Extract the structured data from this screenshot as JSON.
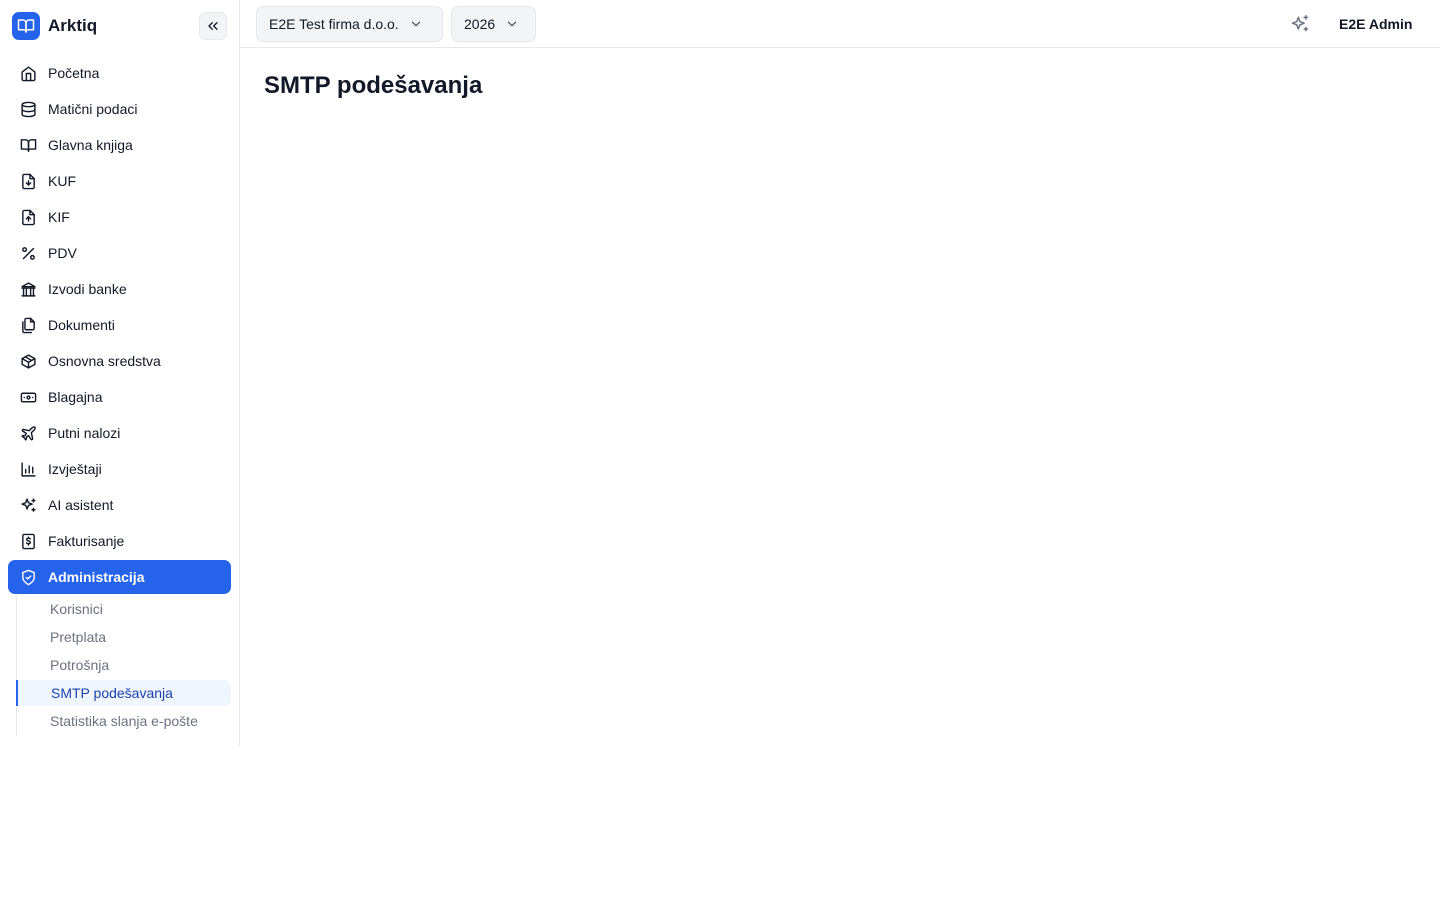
{
  "app": {
    "name": "Arktiq"
  },
  "sidebar": {
    "items": [
      {
        "label": "Početna",
        "icon": "home-icon"
      },
      {
        "label": "Matični podaci",
        "icon": "database-icon"
      },
      {
        "label": "Glavna knjiga",
        "icon": "book-open-icon"
      },
      {
        "label": "KUF",
        "icon": "file-download-icon"
      },
      {
        "label": "KIF",
        "icon": "file-upload-icon"
      },
      {
        "label": "PDV",
        "icon": "percent-icon"
      },
      {
        "label": "Izvodi banke",
        "icon": "bank-icon"
      },
      {
        "label": "Dokumenti",
        "icon": "files-icon"
      },
      {
        "label": "Osnovna sredstva",
        "icon": "package-icon"
      },
      {
        "label": "Blagajna",
        "icon": "banknote-icon"
      },
      {
        "label": "Putni nalozi",
        "icon": "plane-icon"
      },
      {
        "label": "Izvještaji",
        "icon": "bar-chart-icon"
      },
      {
        "label": "AI asistent",
        "icon": "sparkles-icon"
      },
      {
        "label": "Fakturisanje",
        "icon": "receipt-dollar-icon"
      },
      {
        "label": "Administracija",
        "icon": "shield-check-icon",
        "active": true
      }
    ],
    "subitems": [
      {
        "label": "Korisnici"
      },
      {
        "label": "Pretplata"
      },
      {
        "label": "Potrošnja"
      },
      {
        "label": "SMTP podešavanja",
        "active": true
      },
      {
        "label": "Statistika slanja e-pošte"
      }
    ]
  },
  "topbar": {
    "company": "E2E Test firma d.o.o.",
    "year": "2026",
    "user": "E2E Admin"
  },
  "main": {
    "title": "SMTP podešavanja"
  },
  "colors": {
    "accent": "#2563eb",
    "accent_soft": "#eff6ff",
    "border": "#e5e7eb"
  }
}
